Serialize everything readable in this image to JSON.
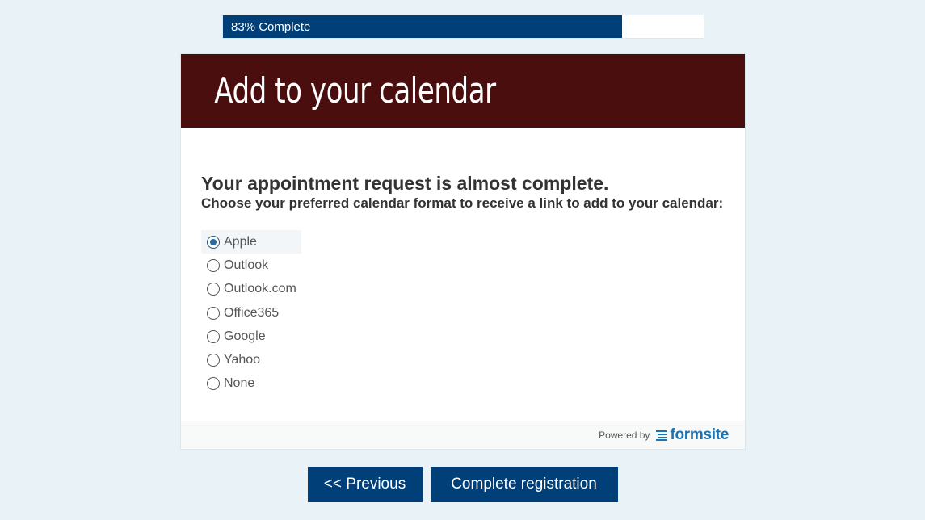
{
  "progress": {
    "label": "83% Complete",
    "fraction": 0.83
  },
  "header": {
    "title": "Add to your calendar"
  },
  "form": {
    "headline": "Your appointment request is almost complete.",
    "instruction": "Choose your preferred calendar format to receive a link to add to your calendar:",
    "selected": "Apple",
    "options": [
      {
        "label": "Apple"
      },
      {
        "label": "Outlook"
      },
      {
        "label": "Outlook.com"
      },
      {
        "label": "Office365"
      },
      {
        "label": "Google"
      },
      {
        "label": "Yahoo"
      },
      {
        "label": "None"
      }
    ]
  },
  "footer": {
    "powered_by": "Powered by",
    "brand": "formsite",
    "brand_color": "#1f73b0"
  },
  "buttons": {
    "previous": "<< Previous",
    "complete": "Complete registration"
  },
  "colors": {
    "primary": "#003f78",
    "header_bg": "#4a0e0e",
    "page_bg": "#e9f2f7"
  }
}
